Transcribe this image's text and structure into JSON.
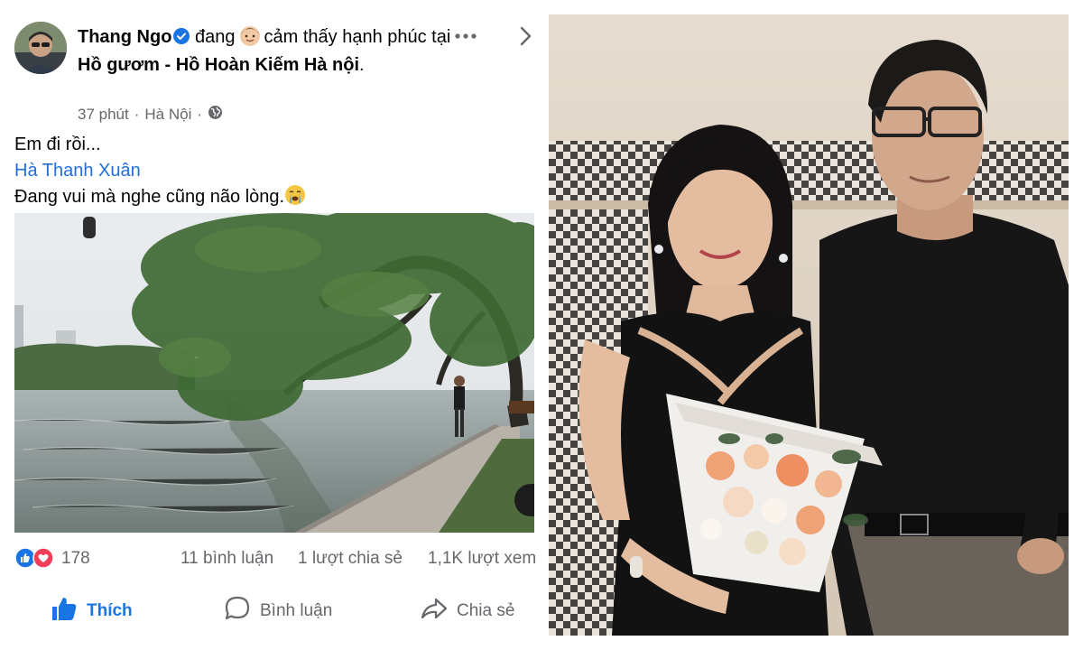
{
  "post": {
    "author": "Thang Ngo",
    "feeling_prefix": "đang",
    "feeling_text": "cảm thấy hạnh phúc tại",
    "location": "Hồ gươm - Hồ Hoàn Kiếm Hà nội",
    "location_suffix": ".",
    "time": "37 phút",
    "separator": "·",
    "place": "Hà Nội",
    "privacy_icon": "globe-icon",
    "lines": {
      "line1": "Em đi rồi...",
      "mention": "Hà Thanh Xuân",
      "line3": "Đang vui mà nghe cũng não lòng."
    },
    "stats": {
      "reactions": "178",
      "comments": "11 bình luận",
      "shares": "1 lượt chia sẻ",
      "views": "1,1K lượt xem"
    },
    "actions": {
      "like": "Thích",
      "comment": "Bình luận",
      "share": "Chia sẻ"
    }
  },
  "colors": {
    "accent": "#1b74e4",
    "mention": "#216fdb",
    "muted": "#65676b"
  }
}
